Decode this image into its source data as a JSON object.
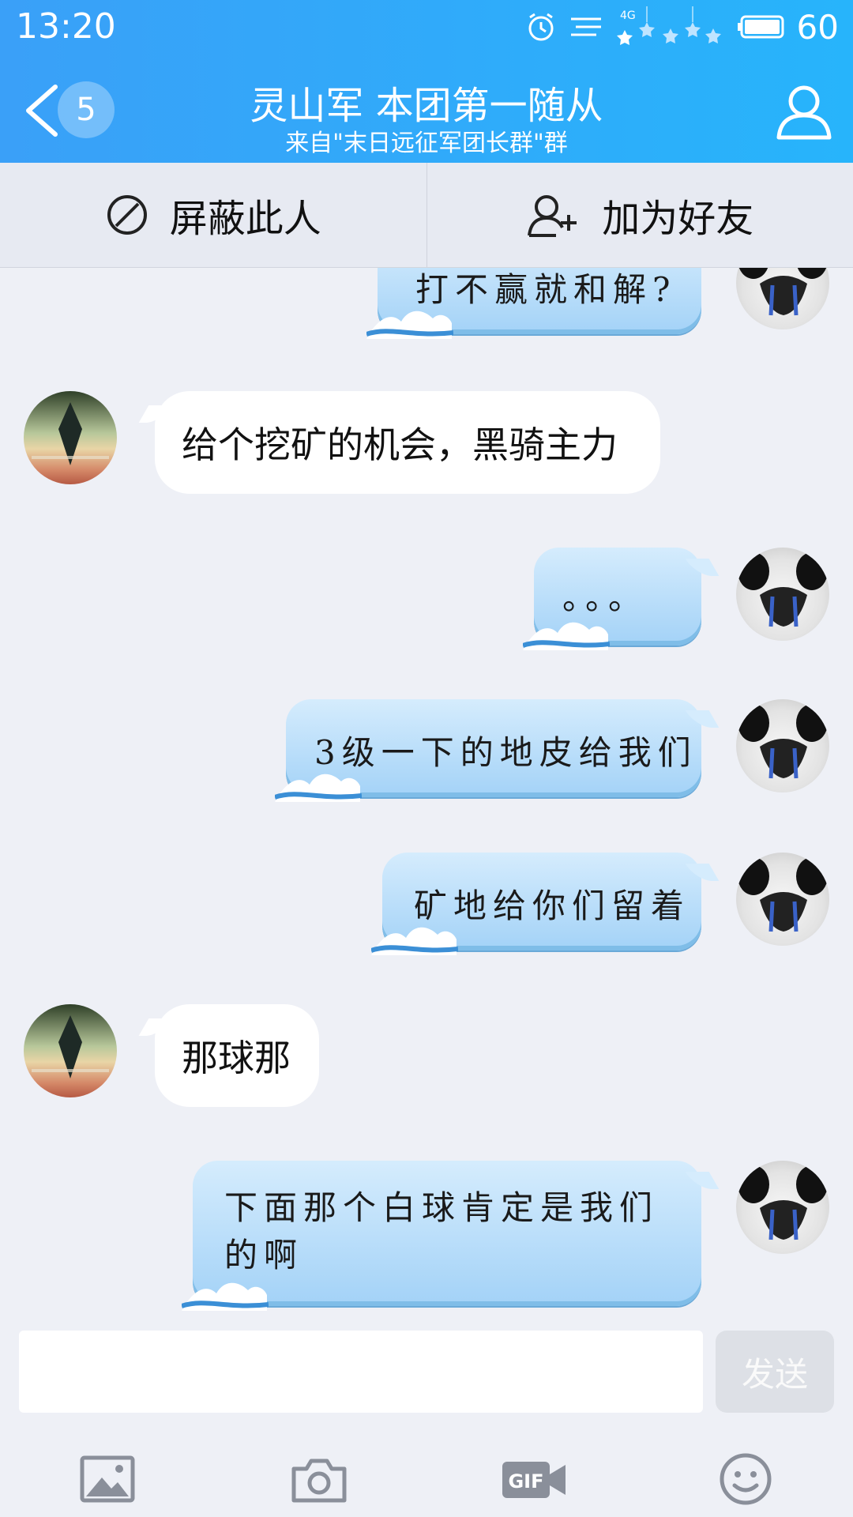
{
  "status": {
    "time": "13:20",
    "network": "4G",
    "battery": "60"
  },
  "header": {
    "badge": "5",
    "title": "灵山军 本团第一随从",
    "subtitle": "来自\"末日远征军团长群\"群"
  },
  "actions": {
    "block": "屏蔽此人",
    "add_friend": "加为好友"
  },
  "messages": [
    {
      "side": "right",
      "text": "打不赢就和解?"
    },
    {
      "side": "left",
      "text": "给个挖矿的机会，黑骑主力"
    },
    {
      "side": "right",
      "text": "。。。"
    },
    {
      "side": "right",
      "text": "3级一下的地皮给我们"
    },
    {
      "side": "right",
      "text": "矿地给你们留着"
    },
    {
      "side": "left",
      "text": "那球那"
    },
    {
      "side": "right",
      "text": "下面那个白球肯定是我们的啊"
    }
  ],
  "input": {
    "value": "",
    "placeholder": "",
    "send_label": "发送"
  },
  "toolbar": [
    "image-icon",
    "camera-icon",
    "gif-icon",
    "emoji-icon"
  ],
  "colors": {
    "header": "#2aaaf8",
    "chat_bg": "#eef0f6",
    "right_bubble": "#a9d6f8",
    "left_bubble": "#ffffff"
  }
}
